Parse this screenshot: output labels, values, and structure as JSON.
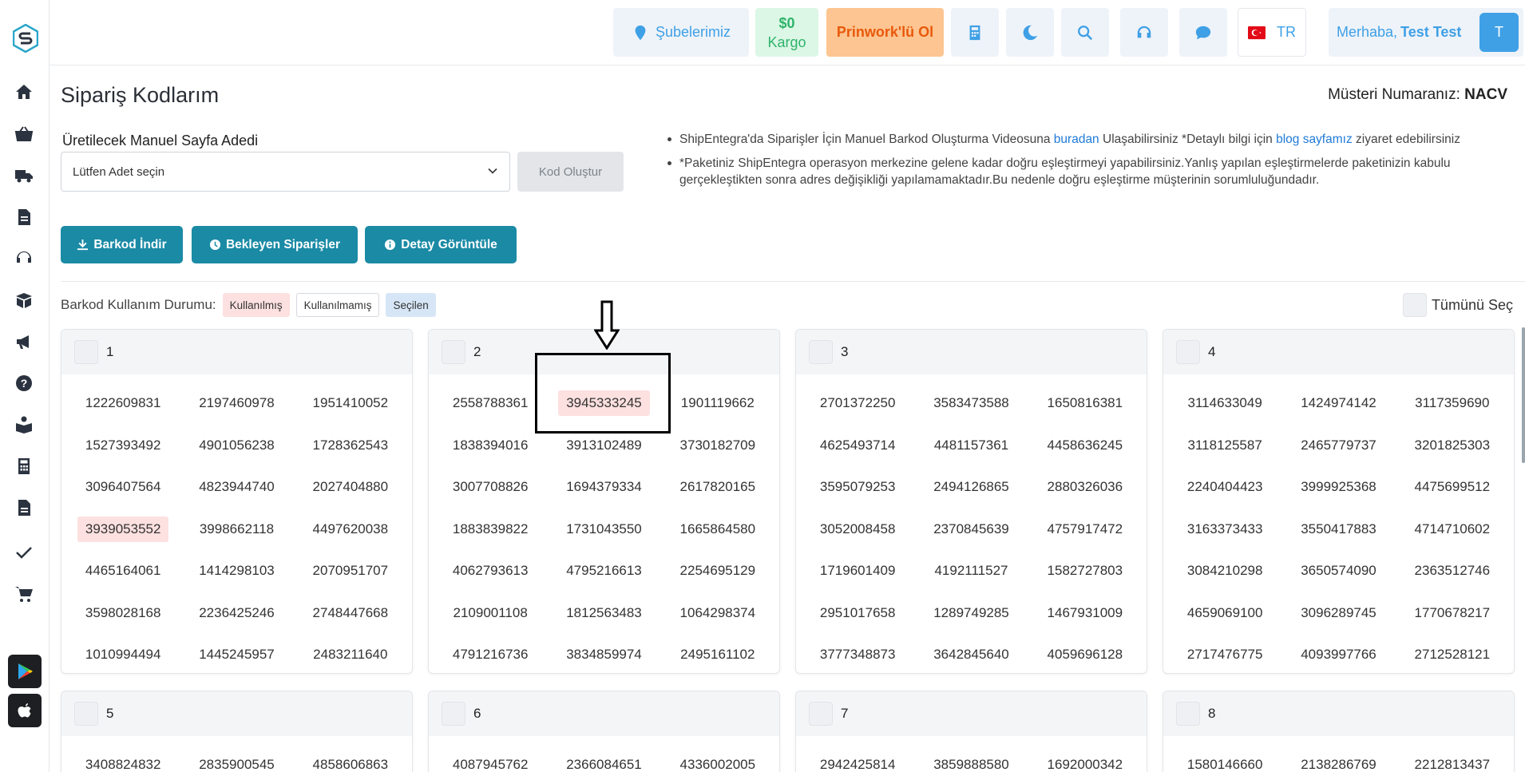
{
  "header": {
    "branches": "Şubelerimiz",
    "cargo_line1": "$0",
    "cargo_line2": "Kargo",
    "prinwork": "Prinwork'lü Ol",
    "language": "TR",
    "greeting": "Merhaba,",
    "user_name": "Test Test",
    "avatar_initial": "T"
  },
  "page": {
    "title": "Sipariş Kodlarım",
    "customer_label": "Müsteri Numaranız:",
    "customer_no": "NACV",
    "field_label": "Üretilecek Manuel Sayfa Adedi",
    "select_placeholder": "Lütfen Adet seçin",
    "generate_button": "Kod Oluştur",
    "info_1_a": "ShipEntegra'da Siparişler İçin Manuel Barkod Oluşturma Videosuna ",
    "info_1_link1": "buradan",
    "info_1_b": " Ulaşabilirsiniz *Detaylı bilgi için ",
    "info_1_link2": "blog sayfamız",
    "info_1_c": " ziyaret edebilirsiniz",
    "info_2": "*Paketiniz ShipEntegra operasyon merkezine gelene kadar doğru eşleştirmeyi yapabilirsiniz.Yanlış yapılan eşleştirmelerde paketinizin kabulu gerçekleştikten sonra adres değişikliği yapılamamaktadır.Bu nedenle doğru eşleştirme müşterinin sorumluluğundadır.",
    "download_button": "Barkod İndir",
    "pending_button": "Bekleyen Siparişler",
    "detail_button": "Detay Görüntüle",
    "usage_label": "Barkod Kullanım Durumu:",
    "badge_used": "Kullanılmış",
    "badge_unused": "Kullanılmamış",
    "badge_selected": "Seçilen",
    "select_all": "Tümünü Seç"
  },
  "colors": {
    "accent": "#1a8aa5",
    "topbar_blue": "#3fa0e6",
    "used": "#fde0e0",
    "selected": "#d6e6f7"
  },
  "cards": [
    {
      "number": "1",
      "codes": [
        "1222609831",
        "2197460978",
        "1951410052",
        "1527393492",
        "4901056238",
        "1728362543",
        "3096407564",
        "4823944740",
        "2027404880",
        "3939053552",
        "3998662118",
        "4497620038",
        "4465164061",
        "1414298103",
        "2070951707",
        "3598028168",
        "2236425246",
        "2748447668",
        "1010994494",
        "1445245957",
        "2483211640"
      ],
      "used": [
        "3939053552"
      ]
    },
    {
      "number": "2",
      "codes": [
        "2558788361",
        "3945333245",
        "1901119662",
        "1838394016",
        "3913102489",
        "3730182709",
        "3007708826",
        "1694379334",
        "2617820165",
        "1883839822",
        "1731043550",
        "1665864580",
        "4062793613",
        "4795216613",
        "2254695129",
        "2109001108",
        "1812563483",
        "1064298374",
        "4791216736",
        "3834859974",
        "2495161102"
      ],
      "used": [
        "3945333245"
      ]
    },
    {
      "number": "3",
      "codes": [
        "2701372250",
        "3583473588",
        "1650816381",
        "4625493714",
        "4481157361",
        "4458636245",
        "3595079253",
        "2494126865",
        "2880326036",
        "3052008458",
        "2370845639",
        "4757917472",
        "1719601409",
        "4192111527",
        "1582727803",
        "2951017658",
        "1289749285",
        "1467931009",
        "3777348873",
        "3642845640",
        "4059696128"
      ],
      "used": []
    },
    {
      "number": "4",
      "codes": [
        "3114633049",
        "1424974142",
        "3117359690",
        "3118125587",
        "2465779737",
        "3201825303",
        "2240404423",
        "3999925368",
        "4475699512",
        "3163373433",
        "3550417883",
        "4714710602",
        "3084210298",
        "3650574090",
        "2363512746",
        "4659069100",
        "3096289745",
        "1770678217",
        "2717476775",
        "4093997766",
        "2712528121"
      ],
      "used": []
    },
    {
      "number": "5",
      "codes": [
        "3408824832",
        "2835900545",
        "4858606863"
      ],
      "used": []
    },
    {
      "number": "6",
      "codes": [
        "4087945762",
        "2366084651",
        "4336002005"
      ],
      "used": []
    },
    {
      "number": "7",
      "codes": [
        "2942425814",
        "3859888580",
        "1692000342"
      ],
      "used": []
    },
    {
      "number": "8",
      "codes": [
        "1580146660",
        "2138286769",
        "2212813437"
      ],
      "used": []
    }
  ]
}
